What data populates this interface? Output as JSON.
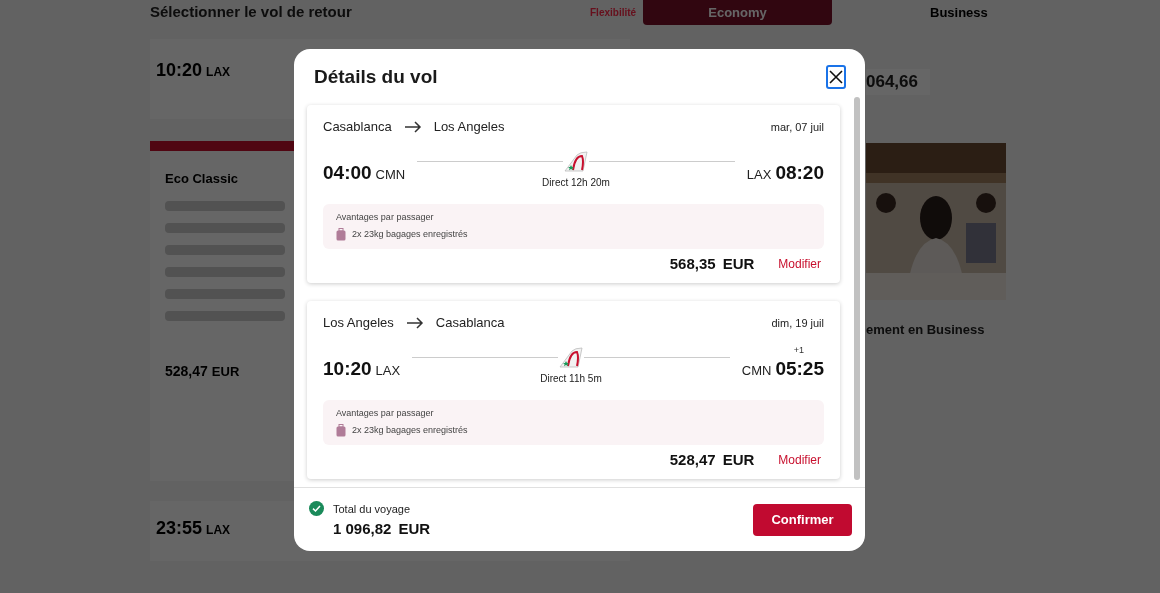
{
  "background": {
    "heading": "Sélectionner le vol de retour",
    "filter": "Flexibilité",
    "cabins": [
      {
        "label": "Economy",
        "selected": true
      },
      {
        "label": "Business",
        "selected": false
      }
    ],
    "first_time": "10:20",
    "first_airport": "LAX",
    "fare_name": "Eco Classic",
    "fare_price": "528,47",
    "fare_currency": "EUR",
    "second_time": "23:55",
    "second_airport": "LAX",
    "right_price": "064,66",
    "upgrade_title": "ement en Business"
  },
  "dialog": {
    "title": "Détails du vol",
    "flights": [
      {
        "from": "Casablanca",
        "to": "Los Angeles",
        "date": "mar, 07 juil",
        "dep_time": "04:00",
        "dep_airport": "CMN",
        "arr_airport": "LAX",
        "arr_time": "08:20",
        "duration": "Direct 12h 20m",
        "perks_title": "Avantages par passager",
        "perks": [
          "2x 23kg bagages enregistrés"
        ],
        "price": "568,35",
        "currency": "EUR",
        "action": "Modifier"
      },
      {
        "from": "Los Angeles",
        "to": "Casablanca",
        "date": "dim, 19 juil",
        "dep_time": "10:20",
        "dep_airport": "LAX",
        "arr_airport": "CMN",
        "arr_time": "05:25",
        "day_offset": "+1",
        "duration": "Direct 11h 5m",
        "perks_title": "Avantages par passager",
        "perks": [
          "2x 23kg bagages enregistrés"
        ],
        "price": "528,47",
        "currency": "EUR",
        "action": "Modifier"
      }
    ],
    "total_label": "Total du voyage",
    "total_price": "1 096,82",
    "total_currency": "EUR",
    "confirm": "Confirmer"
  }
}
